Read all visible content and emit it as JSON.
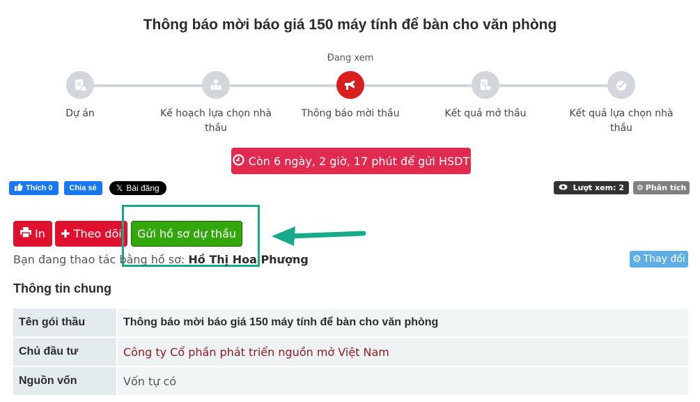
{
  "page": {
    "title": "Thông báo mời báo giá 150 máy tính để bàn cho văn phòng"
  },
  "stepper": {
    "current_label": "Đang xem",
    "steps": [
      {
        "label": "Dự án",
        "icon": "project-clipboard-icon",
        "active": false
      },
      {
        "label": "Kế hoạch lựa chọn nhà thầu",
        "icon": "org-chart-icon",
        "active": false
      },
      {
        "label": "Thông báo mời thầu",
        "icon": "megaphone-icon",
        "active": true
      },
      {
        "label": "Kết quả mở thầu",
        "icon": "clipboard-shield-icon",
        "active": false
      },
      {
        "label": "Kết quả lựa chọn nhà thầu",
        "icon": "badge-check-icon",
        "active": false
      }
    ]
  },
  "countdown": {
    "icon": "clock-icon",
    "text": "Còn 6 ngày, 2 giờ, 17 phút để gửi HSDT"
  },
  "social": {
    "like_label": "Thích 0",
    "share_label": "Chia sẻ",
    "x_post_label": "Bài đăng"
  },
  "stats": {
    "views_label": "Lượt xem: 2",
    "analysis_label": "Phân tích"
  },
  "actions": {
    "print_label": "In",
    "follow_label": "Theo dõi",
    "submit_label": "Gửi hồ sơ dự thầu"
  },
  "profile": {
    "prefix": "Bạn đang thao tác bằng hồ sơ:",
    "name": "Hồ Thị Hoa Phượng",
    "change_label": "Thay đổi"
  },
  "general_info": {
    "title": "Thông tin chung",
    "rows": [
      {
        "key": "Tên gói thầu",
        "value": "Thông báo mời báo giá 150 máy tính để bàn cho văn phòng"
      },
      {
        "key": "Chủ đầu tư",
        "value": "Công ty Cổ phần phát triển nguồn mở Việt Nam"
      },
      {
        "key": "Nguồn vốn",
        "value": "Vốn tự có"
      }
    ]
  },
  "colors": {
    "accent_red": "#e0112f",
    "submit_green": "#33a80d",
    "annotation_teal": "#16a98a",
    "countdown_red": "#e02a4f"
  }
}
